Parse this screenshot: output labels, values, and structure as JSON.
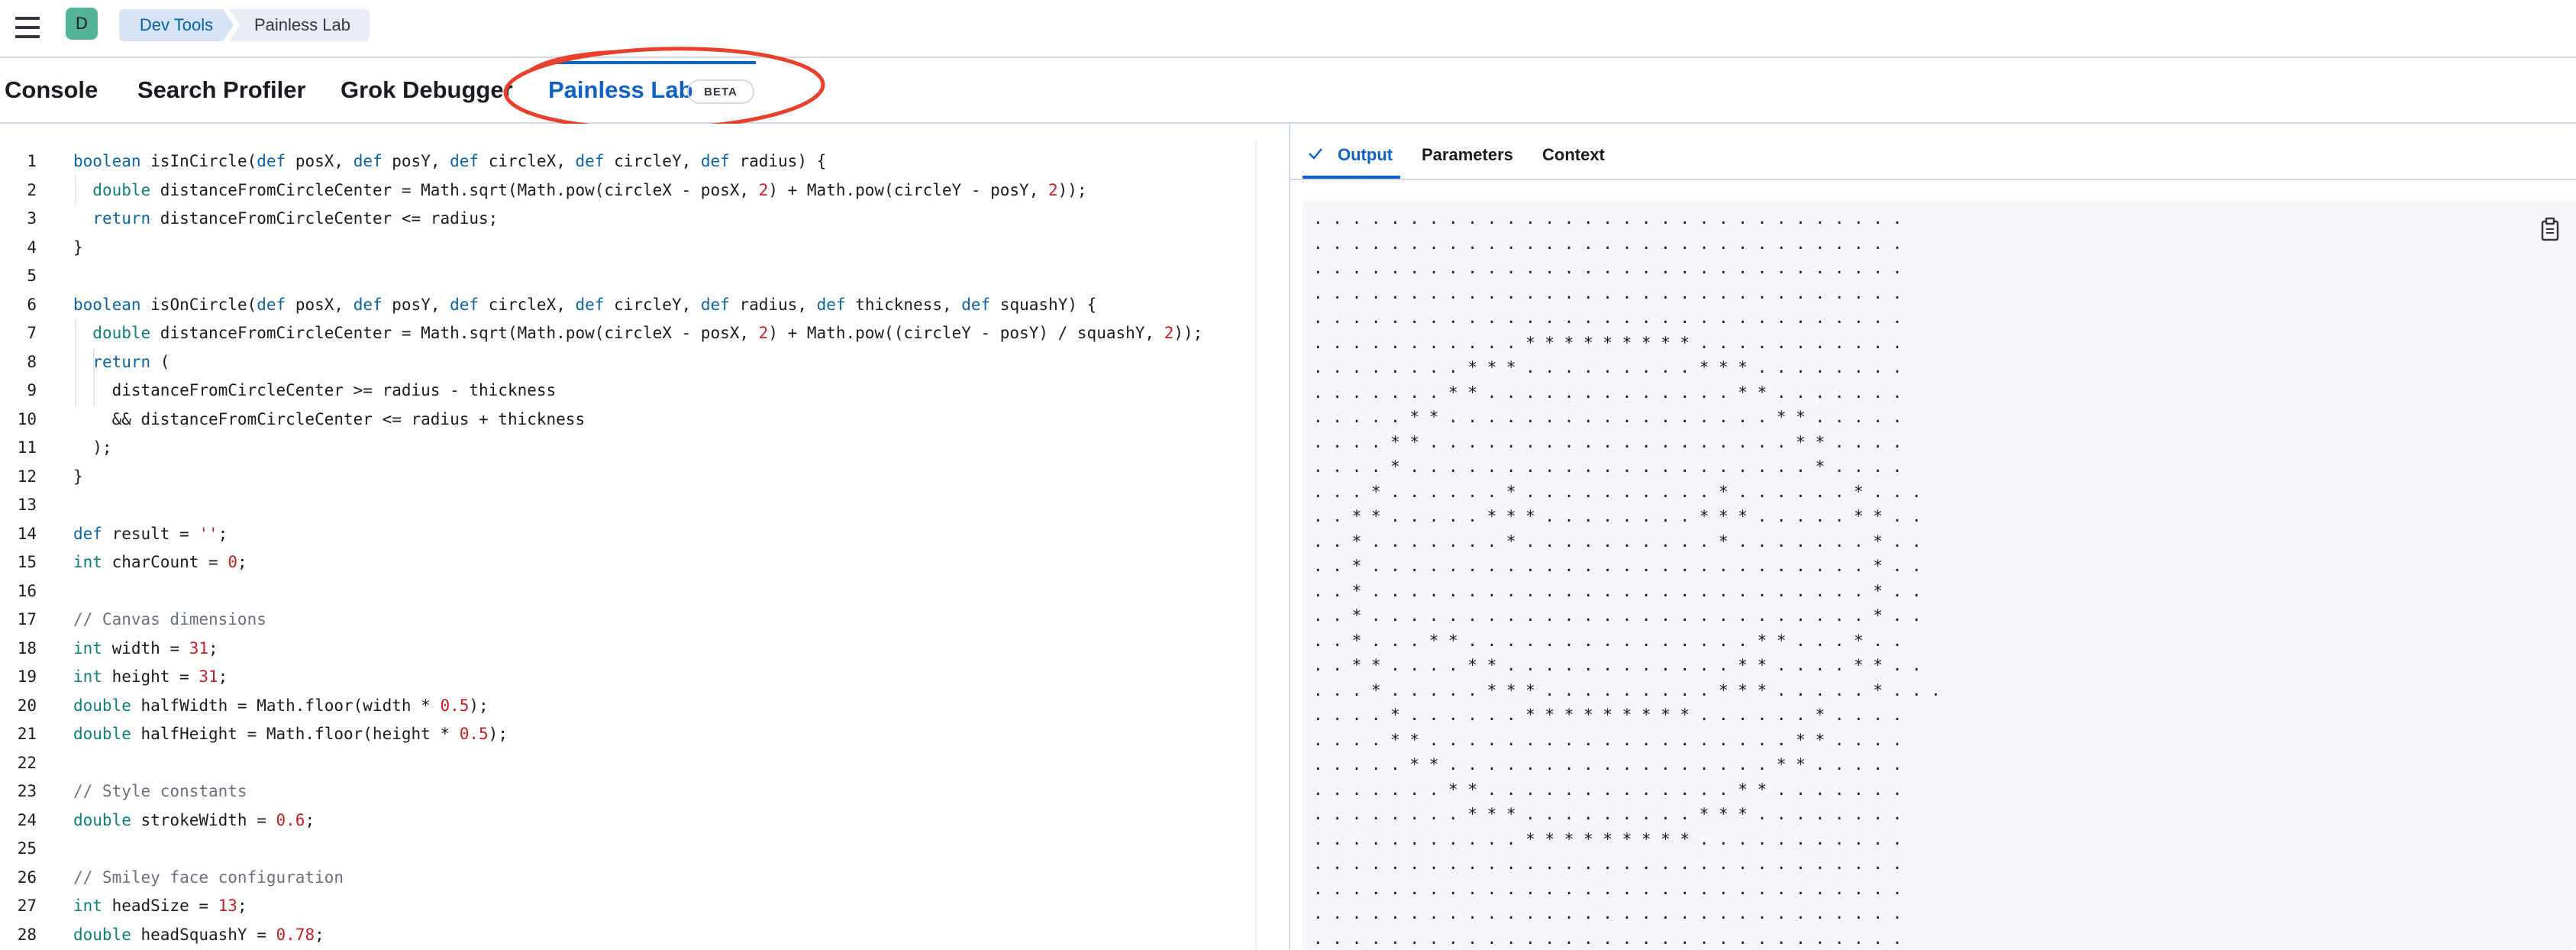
{
  "header": {
    "avatar_letter": "D",
    "breadcrumbs": [
      "Dev Tools",
      "Painless Lab"
    ]
  },
  "tabs": [
    {
      "label": "Console"
    },
    {
      "label": "Search Profiler"
    },
    {
      "label": "Grok Debugger"
    },
    {
      "label": "Painless Lab",
      "active": true,
      "badge": "BETA"
    }
  ],
  "colors": {
    "accent": "#0f62c4",
    "annotation": "#e8402a",
    "avatar": "#54b399"
  },
  "editor": {
    "line_numbers": [
      "1",
      "2",
      "3",
      "4",
      "5",
      "6",
      "7",
      "8",
      "9",
      "10",
      "11",
      "12",
      "13",
      "14",
      "15",
      "16",
      "17",
      "18",
      "19",
      "20",
      "21",
      "22",
      "23",
      "24",
      "25",
      "26",
      "27",
      "28"
    ],
    "lines": [
      "boolean isInCircle(def posX, def posY, def circleX, def circleY, def radius) {",
      "  double distanceFromCircleCenter = Math.sqrt(Math.pow(circleX - posX, 2) + Math.pow(circleY - posY, 2));",
      "  return distanceFromCircleCenter <= radius;",
      "}",
      "",
      "boolean isOnCircle(def posX, def posY, def circleX, def circleY, def radius, def thickness, def squashY) {",
      "  double distanceFromCircleCenter = Math.sqrt(Math.pow(circleX - posX, 2) + Math.pow((circleY - posY) / squashY, 2));",
      "  return (",
      "    distanceFromCircleCenter >= radius - thickness",
      "    && distanceFromCircleCenter <= radius + thickness",
      "  );",
      "}",
      "",
      "def result = '';",
      "int charCount = 0;",
      "",
      "// Canvas dimensions",
      "int width = 31;",
      "int height = 31;",
      "double halfWidth = Math.floor(width * 0.5);",
      "double halfHeight = Math.floor(height * 0.5);",
      "",
      "// Style constants",
      "double strokeWidth = 0.6;",
      "",
      "// Smiley face configuration",
      "int headSize = 13;",
      "double headSquashY = 0.78;"
    ]
  },
  "output_panel": {
    "tabs": [
      {
        "label": "Output",
        "active": true,
        "icon": "check-icon"
      },
      {
        "label": "Parameters"
      },
      {
        "label": "Context"
      }
    ],
    "copy_icon": "clipboard-icon",
    "lines": [
      ". . . . . . . . . . . . . . . . . . . . . . . . . . . . . . .",
      ". . . . . . . . . . . . . . . . . . . . . . . . . . . . . . .",
      ". . . . . . . . . . . . . . . . . . . . . . . . . . . . . . .",
      ". . . . . . . . . . . . . . . . . . . . . . . . . . . . . . .",
      ". . . . . . . . . . . . . . . . . . . . . . . . . . . . . . .",
      ". . . . . . . . . . . * * * * * * * * * . . . . . . . . . . .",
      ". . . . . . . . * * * . . . . . . . . . * * * . . . . . . . .",
      ". . . . . . . * * . . . . . . . . . . . . . * * . . . . . . .",
      ". . . . . * * . . . . . . . . . . . . . . . . . * * . . . . .",
      ". . . . * * . . . . . . . . . . . . . . . . . . . * * . . . .",
      ". . . . * . . . . . . . . . . . . . . . . . . . . . * . . . .",
      ". . . * . . . . . . * . . . . . . . . . . * . . . . . . * . . .",
      ". . * * . . . . . * * * . . . . . . . . * * * . . . . . * * . .",
      ". . * . . . . . . . * . . . . . . . . . . * . . . . . . . * . .",
      ". . * . . . . . . . . . . . . . . . . . . . . . . . . . . * . .",
      ". . * . . . . . . . . . . . . . . . . . . . . . . . . . . * . .",
      ". . * . . . . . . . . . . . . . . . . . . . . . . . . . . * . .",
      ". . * . . . * * . . . . . . . . . . . . . . . * * . . . * . .",
      ". . * * . . . . * * . . . . . . . . . . . . * * . . . . * * . .",
      ". . . * . . . . . * * * . . . . . . . . . * * * . . . . . * . . .",
      ". . . . * . . . . . . * * * * * * * * * . . . . . . * . . . .",
      ". . . . * * . . . . . . . . . . . . . . . . . . . * * . . . .",
      ". . . . . * * . . . . . . . . . . . . . . . . . * * . . . . .",
      ". . . . . . . * * . . . . . . . . . . . . . * * . . . . . . .",
      ". . . . . . . . * * * . . . . . . . . . * * * . . . . . . . .",
      ". . . . . . . . . . . * * * * * * * * * . . . . . . . . . . .",
      ". . . . . . . . . . . . . . . . . . . . . . . . . . . . . . .",
      ". . . . . . . . . . . . . . . . . . . . . . . . . . . . . . .",
      ". . . . . . . . . . . . . . . . . . . . . . . . . . . . . . .",
      ". . . . . . . . . . . . . . . . . . . . . . . . . . . . . . ."
    ]
  }
}
